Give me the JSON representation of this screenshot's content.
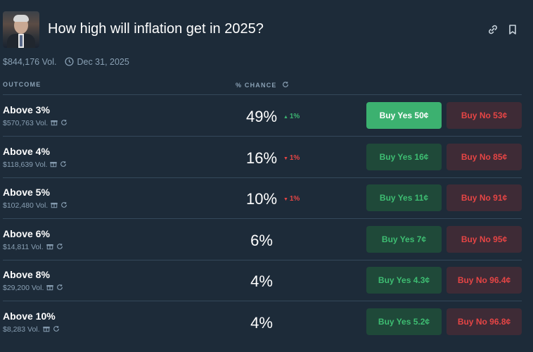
{
  "market": {
    "title": "How high will inflation get in 2025?",
    "volume": "$844,176 Vol.",
    "end_date": "Dec 31, 2025"
  },
  "columns": {
    "outcome": "OUTCOME",
    "chance": "% CHANCE"
  },
  "outcomes": [
    {
      "name": "Above 3%",
      "volume": "$570,763 Vol.",
      "chance": "49%",
      "delta": "1%",
      "delta_dir": "up",
      "buy_yes": "Buy Yes 50¢",
      "buy_no": "Buy No 53¢",
      "yes_selected": true
    },
    {
      "name": "Above 4%",
      "volume": "$118,639 Vol.",
      "chance": "16%",
      "delta": "1%",
      "delta_dir": "down",
      "buy_yes": "Buy Yes 16¢",
      "buy_no": "Buy No 85¢",
      "yes_selected": false
    },
    {
      "name": "Above 5%",
      "volume": "$102,480 Vol.",
      "chance": "10%",
      "delta": "1%",
      "delta_dir": "down",
      "buy_yes": "Buy Yes 11¢",
      "buy_no": "Buy No 91¢",
      "yes_selected": false
    },
    {
      "name": "Above 6%",
      "volume": "$14,811 Vol.",
      "chance": "6%",
      "delta": "",
      "delta_dir": "none",
      "buy_yes": "Buy Yes 7¢",
      "buy_no": "Buy No 95¢",
      "yes_selected": false
    },
    {
      "name": "Above 8%",
      "volume": "$29,200 Vol.",
      "chance": "4%",
      "delta": "",
      "delta_dir": "none",
      "buy_yes": "Buy Yes 4.3¢",
      "buy_no": "Buy No 96.4¢",
      "yes_selected": false
    },
    {
      "name": "Above 10%",
      "volume": "$8,283 Vol.",
      "chance": "4%",
      "delta": "",
      "delta_dir": "none",
      "buy_yes": "Buy Yes 5.2¢",
      "buy_no": "Buy No 96.8¢",
      "yes_selected": false
    }
  ],
  "icons": {
    "header": [
      "link-icon",
      "bookmark-icon"
    ],
    "meta": "clock-icon",
    "row": [
      "gift-icon",
      "refresh-icon"
    ]
  },
  "colors": {
    "background": "#1d2b39",
    "muted_text": "#89a0b4",
    "yes_green": "#3cb170",
    "no_red": "#e64545"
  }
}
